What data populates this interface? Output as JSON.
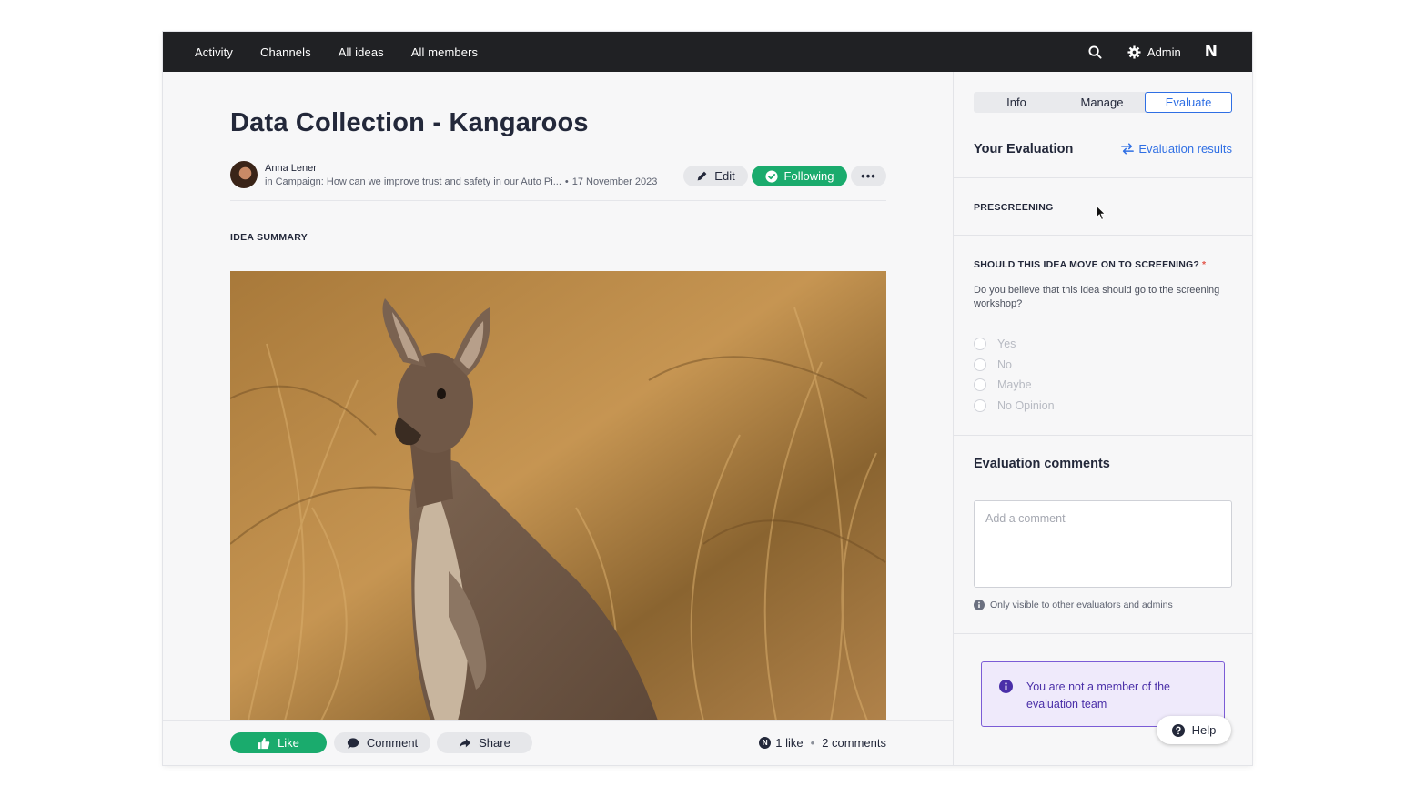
{
  "nav": {
    "items": [
      {
        "label": "Activity"
      },
      {
        "label": "Channels"
      },
      {
        "label": "All ideas"
      },
      {
        "label": "All members"
      }
    ],
    "admin_label": "Admin",
    "brand_letter": "N"
  },
  "idea": {
    "title": "Data Collection - Kangaroos",
    "author": "Anna Lener",
    "campaign": "in Campaign: How can we improve trust and safety in our Auto Pi...",
    "date": "17 November 2023",
    "edit_label": "Edit",
    "following_label": "Following",
    "more_label": "•••",
    "summary_label": "IDEA SUMMARY",
    "image_desc": "kangaroo-photo"
  },
  "actions": {
    "like_label": "Like",
    "comment_label": "Comment",
    "share_label": "Share",
    "badge": "N",
    "likes": "1 like",
    "sep": "•",
    "comments": "2 comments"
  },
  "side": {
    "tabs": [
      {
        "label": "Info"
      },
      {
        "label": "Manage"
      },
      {
        "label": "Evaluate",
        "active": true
      }
    ],
    "your_evaluation": "Your Evaluation",
    "evaluation_results": "Evaluation results",
    "prescreening": "PRESCREENING",
    "question": "SHOULD THIS IDEA MOVE ON TO SCREENING?",
    "required_mark": "*",
    "question_desc": "Do you believe that this idea should go to the screening workshop?",
    "options": [
      "Yes",
      "No",
      "Maybe",
      "No Opinion"
    ],
    "comments_title": "Evaluation comments",
    "comment_placeholder": "Add a comment",
    "visibility_note": "Only visible to other evaluators and admins",
    "notice": "You are not a member of the evaluation team"
  },
  "help_label": "Help",
  "colors": {
    "nav_bg": "#202124",
    "accent_green": "#1aab6d",
    "accent_blue": "#2f6fe4",
    "notice_purple": "#7b5cd6"
  }
}
